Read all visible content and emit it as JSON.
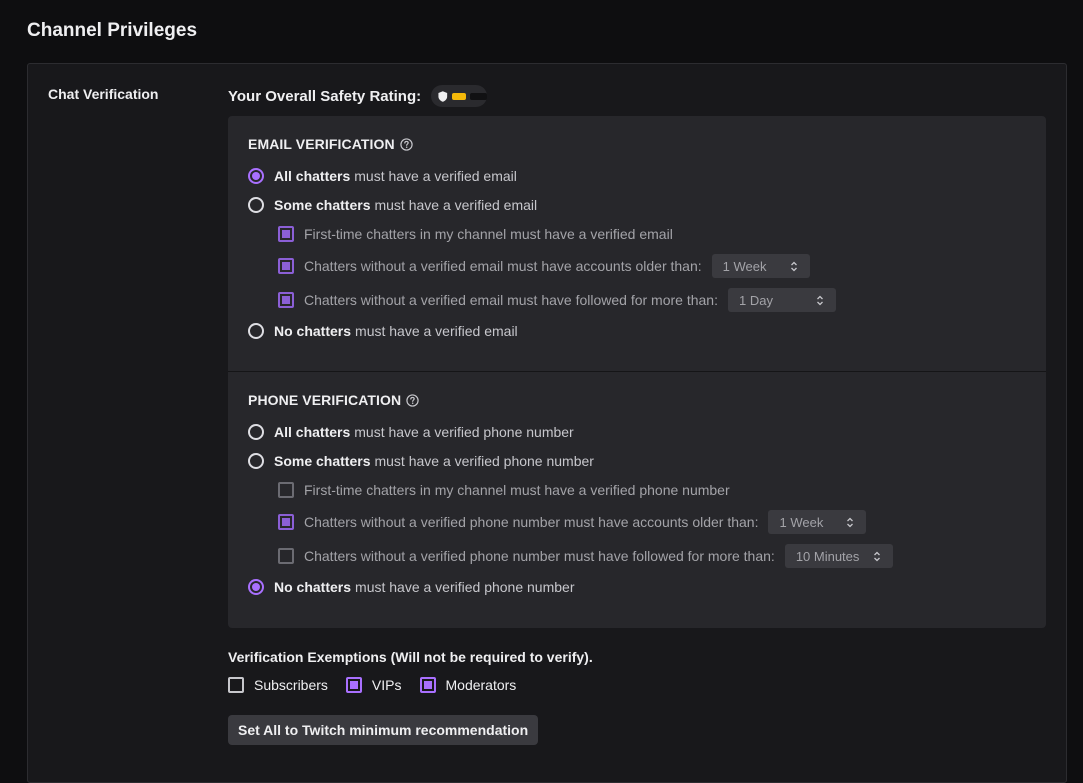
{
  "page_title": "Channel Privileges",
  "left_label": "Chat Verification",
  "safety": {
    "label": "Your Overall Safety Rating:",
    "rating_fraction": 0.3,
    "rating_color": "#f5b90a"
  },
  "email": {
    "title": "EMAIL VERIFICATION",
    "options": [
      {
        "bold": "All chatters",
        "rest": "must have a verified email",
        "selected": true
      },
      {
        "bold": "Some chatters",
        "rest": "must have a verified email",
        "selected": false
      },
      {
        "bold": "No chatters",
        "rest": "must have a verified email",
        "selected": false
      }
    ],
    "sub_options": [
      {
        "label": "First-time chatters in my channel must have a verified email",
        "checked": true
      },
      {
        "label": "Chatters without a verified email must have accounts older than:",
        "checked": true,
        "select": "1 Week"
      },
      {
        "label": "Chatters without a verified email must have followed for more than:",
        "checked": true,
        "select": "1 Day"
      }
    ]
  },
  "phone": {
    "title": "PHONE VERIFICATION",
    "options": [
      {
        "bold": "All chatters",
        "rest": "must have a verified phone number",
        "selected": false
      },
      {
        "bold": "Some chatters",
        "rest": "must have a verified phone number",
        "selected": false
      },
      {
        "bold": "No chatters",
        "rest": "must have a verified phone number",
        "selected": true
      }
    ],
    "sub_options": [
      {
        "label": "First-time chatters in my channel must have a verified phone number",
        "checked": false
      },
      {
        "label": "Chatters without a verified phone number must have accounts older than:",
        "checked": true,
        "select": "1 Week"
      },
      {
        "label": "Chatters without a verified phone number must have followed for more than:",
        "checked": false,
        "select": "10 Minutes"
      }
    ]
  },
  "exemptions": {
    "title": "Verification Exemptions (Will not be required to verify).",
    "items": [
      {
        "label": "Subscribers",
        "checked": false
      },
      {
        "label": "VIPs",
        "checked": true
      },
      {
        "label": "Moderators",
        "checked": true
      }
    ]
  },
  "action_button": "Set All to Twitch minimum recommendation",
  "colors": {
    "accent": "#a970ff",
    "background": "#0e0e10",
    "card": "#18181b",
    "panel": "#27272b"
  }
}
